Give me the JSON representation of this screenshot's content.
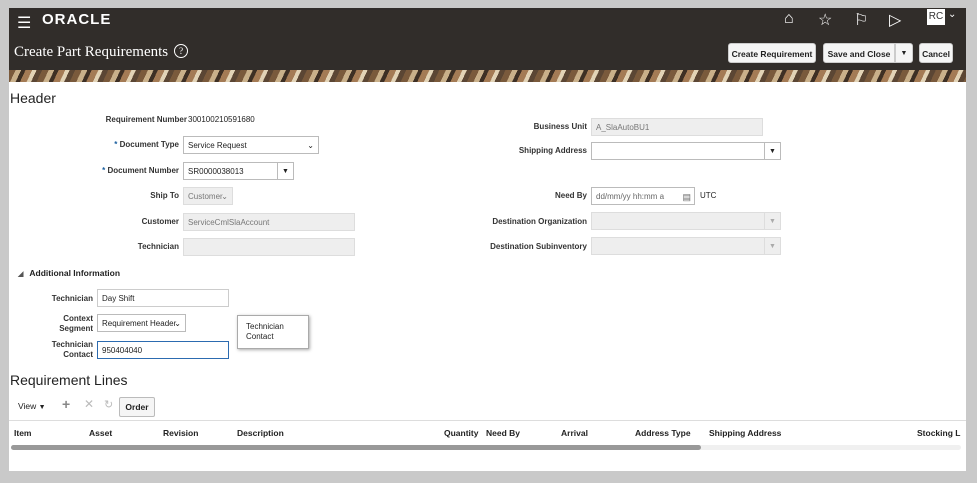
{
  "app": {
    "logo": "ORACLE",
    "avatar": "RC"
  },
  "page": {
    "title": "Create Part Requirements"
  },
  "toolbar": {
    "create": "Create Requirement",
    "save_close": "Save and Close",
    "cancel": "Cancel"
  },
  "header": {
    "section_title": "Header",
    "requirement_number_label": "Requirement Number",
    "requirement_number": "300100210591680",
    "document_type_label": "Document Type",
    "document_type": "Service Request",
    "document_number_label": "Document Number",
    "document_number": "SR0000038013",
    "ship_to_label": "Ship To",
    "ship_to": "Customer",
    "customer_label": "Customer",
    "customer": "ServiceCmlSlaAccount",
    "technician_label": "Technician",
    "technician": "",
    "business_unit_label": "Business Unit",
    "business_unit": "A_SlaAutoBU1",
    "shipping_address_label": "Shipping Address",
    "need_by_label": "Need By",
    "need_by_placeholder": "dd/mm/yy hh:mm a",
    "timezone": "UTC",
    "destination_org_label": "Destination Organization",
    "destination_subinv_label": "Destination Subinventory"
  },
  "additional": {
    "title": "Additional Information",
    "technician_label": "Technician",
    "technician": "Day Shift",
    "context_label_1": "Context",
    "context_label_2": "Segment",
    "context_segment": "Requirement Header",
    "contact_label_1": "Technician",
    "contact_label_2": "Contact",
    "contact": "950404040",
    "tooltip_1": "Technician",
    "tooltip_2": "Contact"
  },
  "lines": {
    "title": "Requirement Lines",
    "view_label": "View",
    "order_btn": "Order",
    "columns": [
      "Item",
      "Asset",
      "Revision",
      "Description",
      "Quantity",
      "Need By",
      "Arrival",
      "Address Type",
      "Shipping Address",
      "Stocking L"
    ]
  }
}
